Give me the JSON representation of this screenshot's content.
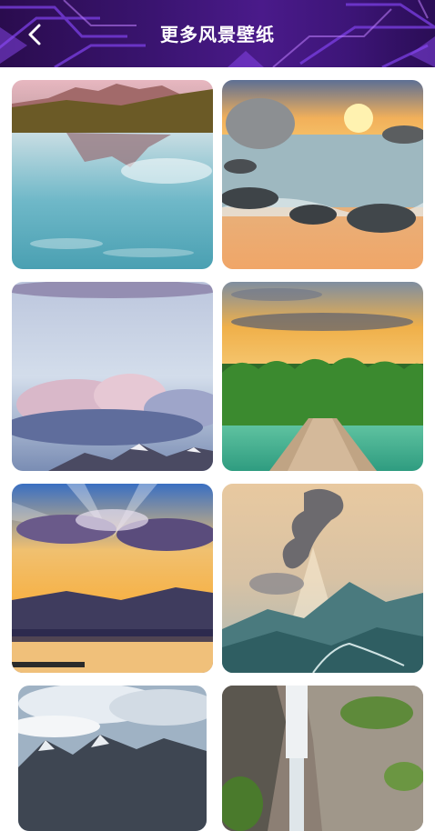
{
  "header": {
    "title": "更多风景壁纸",
    "back_icon": "chevron-left-icon"
  },
  "wallpapers": [
    {
      "name": "mountain-lake-reflection"
    },
    {
      "name": "beach-rocks-sunset"
    },
    {
      "name": "clouds-over-snowy-peaks"
    },
    {
      "name": "tropical-island-pier"
    },
    {
      "name": "sunrays-lake-sunset"
    },
    {
      "name": "sun-rays-over-mountains"
    },
    {
      "name": "cloudy-mountain-range"
    },
    {
      "name": "waterfall-cliffs"
    }
  ]
}
